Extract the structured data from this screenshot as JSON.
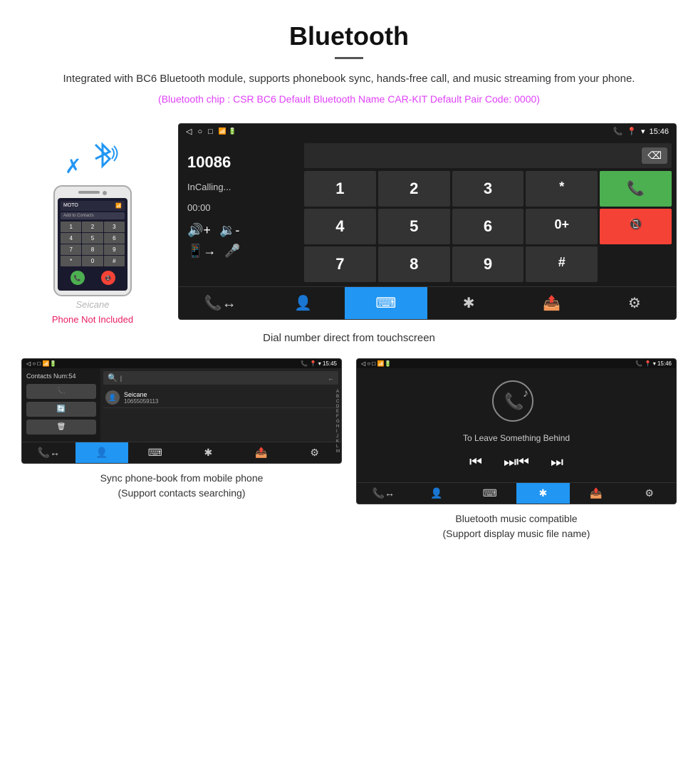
{
  "header": {
    "title": "Bluetooth",
    "description": "Integrated with BC6 Bluetooth module, supports phonebook sync, hands-free call, and music streaming from your phone.",
    "bluetooth_info": "(Bluetooth chip : CSR BC6    Default Bluetooth Name CAR-KIT    Default Pair Code: 0000)"
  },
  "main_screen": {
    "status_bar": {
      "back_icon": "◁",
      "circle_icon": "○",
      "square_icon": "□",
      "signal_icons": "📶",
      "phone_icon": "📞",
      "location_icon": "📍",
      "wifi_icon": "▾",
      "time": "15:46"
    },
    "dialer": {
      "number": "10086",
      "status": "InCalling...",
      "timer": "00:00",
      "backspace": "⌫",
      "keys": [
        "1",
        "2",
        "3",
        "*",
        "4",
        "5",
        "6",
        "0+",
        "7",
        "8",
        "9",
        "#"
      ],
      "call_icon": "📞",
      "end_icon": "📵"
    },
    "bottom_nav": [
      {
        "icon": "📞",
        "label": "phone-transfer",
        "active": false
      },
      {
        "icon": "👤",
        "label": "contacts",
        "active": false
      },
      {
        "icon": "⌨",
        "label": "keypad",
        "active": true
      },
      {
        "icon": "✱",
        "label": "bluetooth",
        "active": false
      },
      {
        "icon": "📤",
        "label": "transfer",
        "active": false
      },
      {
        "icon": "⚙",
        "label": "settings",
        "active": false
      }
    ]
  },
  "phone_mock": {
    "add_contacts": "Add to Contacts",
    "keys": [
      "1",
      "2",
      "3",
      "4",
      "5",
      "6",
      "7",
      "8",
      "9",
      "*",
      "0",
      "#"
    ]
  },
  "phone_not_included": "Phone Not Included",
  "dial_caption": "Dial number direct from touchscreen",
  "contacts_screen": {
    "status_time": "15:45",
    "contacts_num": "Contacts Num:54",
    "actions": [
      "📞",
      "🔄",
      "🗑"
    ],
    "search_placeholder": "Search",
    "contact": {
      "name": "Seicane",
      "number": "10655059113"
    },
    "alpha_letters": [
      "A",
      "B",
      "C",
      "D",
      "E",
      "F",
      "G",
      "H",
      "I",
      "J",
      "K",
      "L",
      "M"
    ]
  },
  "contacts_caption": {
    "line1": "Sync phone-book from mobile phone",
    "line2": "(Support contacts searching)"
  },
  "music_screen": {
    "status_time": "15:46",
    "song_title": "To Leave Something Behind",
    "controls": [
      "⏮",
      "⏭⏮",
      "⏭"
    ]
  },
  "music_caption": {
    "line1": "Bluetooth music compatible",
    "line2": "(Support display music file name)"
  },
  "seicane_watermark": "Seicane"
}
